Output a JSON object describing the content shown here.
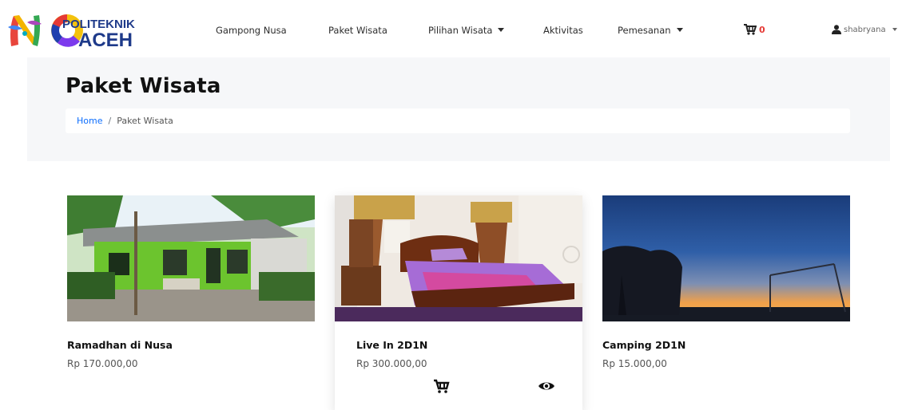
{
  "brand": {
    "logo_text_line1": "POLITEKNIK",
    "logo_text_line2": "ACEH"
  },
  "nav": {
    "items": [
      {
        "label": "Gampong Nusa",
        "dropdown": false
      },
      {
        "label": "Paket Wisata",
        "dropdown": false
      },
      {
        "label": "Pilihan Wisata",
        "dropdown": true
      },
      {
        "label": "Aktivitas",
        "dropdown": false
      },
      {
        "label": "Pemesanan",
        "dropdown": true
      }
    ],
    "cart_icon": "cart-icon",
    "cart_count": "0",
    "user_icon": "user-icon",
    "user_name": "shabryana"
  },
  "header": {
    "title": "Paket Wisata",
    "breadcrumb": {
      "home": "Home",
      "separator": "/",
      "current": "Paket Wisata"
    }
  },
  "packages": [
    {
      "name": "Ramadhan di Nusa",
      "price": "Rp 170.000,00",
      "image": "green house photo"
    },
    {
      "name": "Live In 2D1N",
      "price": "Rp 300.000,00",
      "image": "bedroom photo",
      "actions": [
        "cart-icon",
        "eye-icon"
      ]
    },
    {
      "name": "Camping 2D1N",
      "price": "Rp 15.000,00",
      "image": "sunset photo"
    }
  ],
  "colors": {
    "accent": "#0d6efd",
    "cart_count": "#e53935",
    "header_bg": "#f6f7f9"
  }
}
